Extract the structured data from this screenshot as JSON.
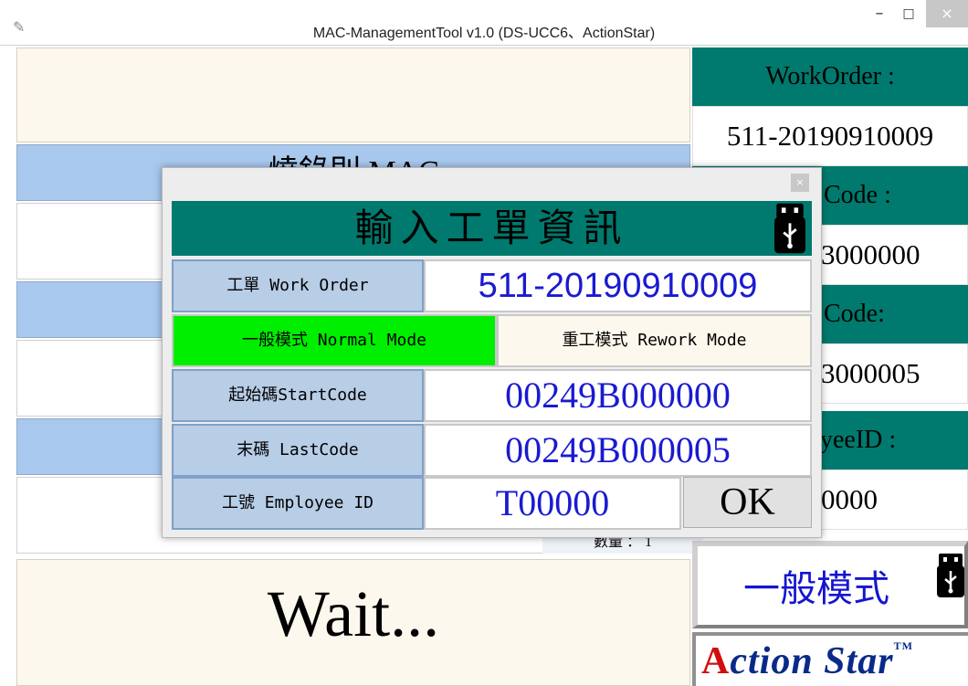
{
  "window": {
    "title": "MAC-ManagementTool v1.0 (DS-UCC6、ActionStar)",
    "minimize": "–",
    "maximize": "□",
    "close": "×"
  },
  "main": {
    "blue_header_1": "燒錄則 MAC",
    "count_label": "數量 ： 1",
    "wait_text": "Wait..."
  },
  "sidebar": {
    "workorder_label": "WorkOrder :",
    "workorder_value": "511-20190910009",
    "startcode_label_partial": "Code :",
    "startcode_value_partial": "3000000",
    "lastcode_label_partial": "Code:",
    "lastcode_value_partial": "3000005",
    "employee_label_partial": "yeeID :",
    "employee_value_partial": "0000",
    "mode_text": "一般模式",
    "logo": {
      "a": "A",
      "rest": "ction Star",
      "tm": "TM"
    }
  },
  "dialog": {
    "close": "×",
    "title": "輸入工單資訊",
    "work_order_label": "工單 Work Order",
    "work_order_value": "511-20190910009",
    "normal_mode": "一般模式 Normal Mode",
    "rework_mode": "重工模式 Rework Mode",
    "start_code_label": "起始碼StartCode",
    "start_code_value": "00249B000000",
    "last_code_label": "末碼 LastCode",
    "last_code_value": "00249B000005",
    "employee_label": "工號 Employee ID",
    "employee_value": "T00000",
    "ok_label": "OK"
  },
  "colors": {
    "teal": "#007a6e",
    "blue_header": "#a8c8ee",
    "cream": "#fdf8ed",
    "value_blue": "#1a1ad0",
    "mode_green": "#00ee00"
  },
  "icons": [
    "app-feather-icon",
    "usb-icon"
  ]
}
